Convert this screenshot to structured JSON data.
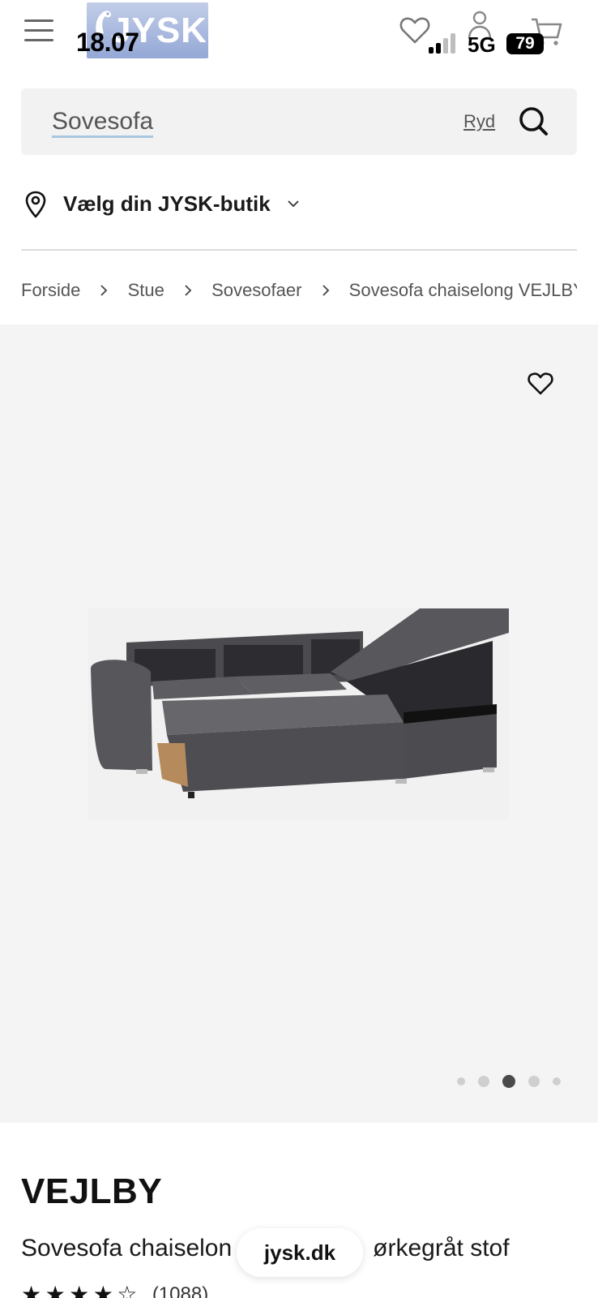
{
  "status_bar": {
    "time": "18.07",
    "network": "5G",
    "battery": "79"
  },
  "header": {
    "logo_text": "JYSK",
    "icons": [
      "hamburger-menu-icon",
      "heart-icon",
      "person-icon",
      "cart-icon"
    ]
  },
  "search": {
    "value": "Sovesofa",
    "clear_label": "Ryd",
    "icon": "search-icon"
  },
  "store": {
    "label": "Vælg din JYSK-butik",
    "icon": "location-pin-icon"
  },
  "breadcrumb": [
    "Forside",
    "Stue",
    "Sovesofaer",
    "Sovesofa chaiselong VEJLBY m"
  ],
  "gallery": {
    "image_count": 5,
    "active_index": 2,
    "background": "#f4f4f4"
  },
  "product": {
    "brand": "VEJLBY",
    "name_before": "Sovesofa chaiselon",
    "name_after": "ørkegråt stof",
    "rating_stars": 4,
    "review_count": "(1088)"
  },
  "browser": {
    "url": "jysk.dk"
  },
  "colors": {
    "accent": "#a9c7df",
    "logo_bg": "#94a8d6",
    "text": "#1a1a1a"
  }
}
